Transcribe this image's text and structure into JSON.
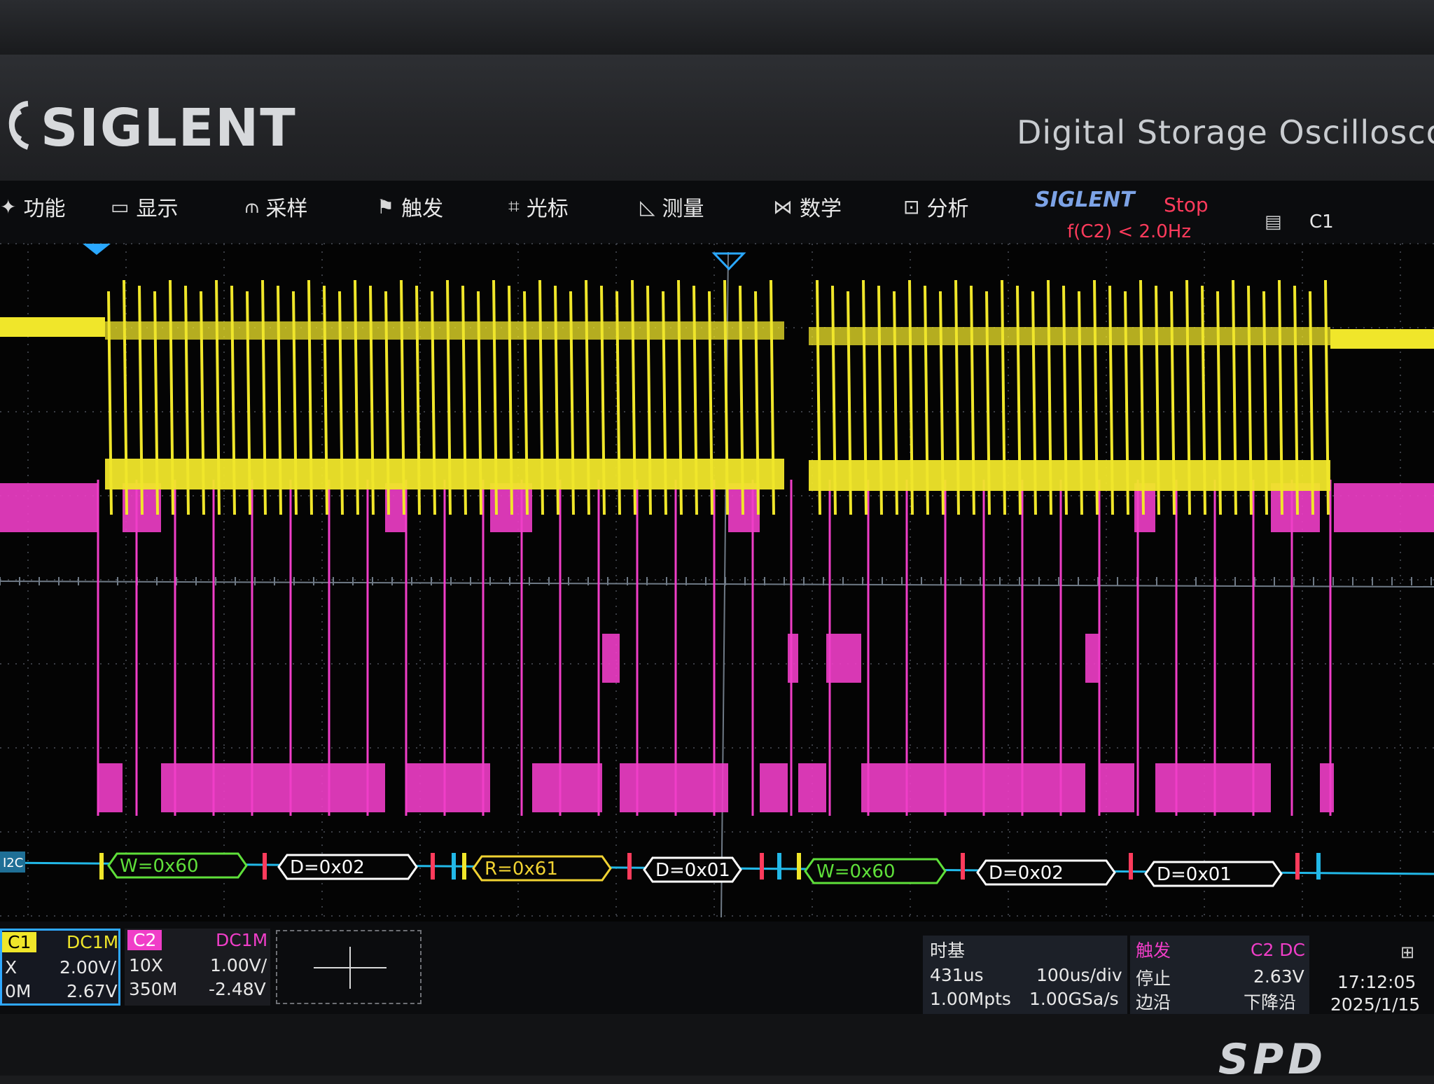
{
  "brand": "SIGLENT",
  "model_text": "Digital Storage Oscillosco",
  "menu": [
    {
      "label": "功能",
      "icon": "function-icon"
    },
    {
      "label": "显示",
      "icon": "display-icon"
    },
    {
      "label": "采样",
      "icon": "acquire-icon"
    },
    {
      "label": "触发",
      "icon": "trigger-flag-icon"
    },
    {
      "label": "光标",
      "icon": "cursor-icon"
    },
    {
      "label": "测量",
      "icon": "measure-icon"
    },
    {
      "label": "数学",
      "icon": "math-icon"
    },
    {
      "label": "分析",
      "icon": "analysis-icon"
    }
  ],
  "status": {
    "brand": "SIGLENT",
    "run_state": "Stop",
    "freq_filter": "f(C2) < 2.0Hz",
    "trigger_source": "C1"
  },
  "colors": {
    "ch1": "#f0e62a",
    "ch2": "#f03ec8",
    "bus": "#22b8e8",
    "write_frame": "#5fe03a",
    "read_frame": "#f0d232",
    "data_frame": "#ffffff",
    "run_state": "#ff3b5c",
    "grid": "#3a3d44"
  },
  "decode": {
    "bus_label": "I2C",
    "frames": [
      {
        "label": "W=0x60",
        "kind": "write"
      },
      {
        "label": "D=0x02",
        "kind": "data"
      },
      {
        "label": "R=0x61",
        "kind": "read"
      },
      {
        "label": "D=0x01",
        "kind": "data"
      },
      {
        "label": "W=0x60",
        "kind": "write"
      },
      {
        "label": "D=0x02",
        "kind": "data"
      },
      {
        "label": "D=0x01",
        "kind": "data"
      }
    ]
  },
  "ch1": {
    "name": "C1",
    "coupling": "DC1M",
    "probe": "X",
    "bandwidth": "0M",
    "scale": "2.00V/",
    "offset": "2.67V"
  },
  "ch2": {
    "name": "C2",
    "coupling": "DC1M",
    "probe": "10X",
    "bandwidth": "350M",
    "scale": "1.00V/",
    "offset": "-2.48V"
  },
  "timebase": {
    "title": "时基",
    "delay": "431us",
    "scale": "100us/div",
    "memory": "1.00Mpts",
    "sample_rate": "1.00GSa/s"
  },
  "trigger": {
    "title": "触发",
    "source": "C2 DC",
    "state": "停止",
    "level": "2.63V",
    "type": "边沿",
    "slope": "下降沿"
  },
  "clock": {
    "time": "17:12:05",
    "date": "2025/1/15"
  },
  "bottom_logo": "SPD"
}
